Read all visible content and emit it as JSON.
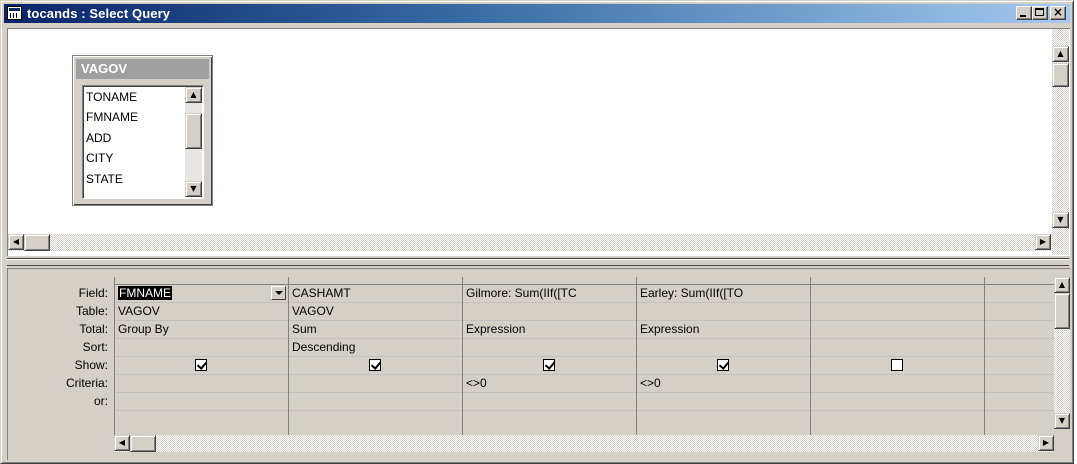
{
  "window": {
    "title": "tocands : Select Query",
    "controls": {
      "minimize": "_",
      "maximize": "□",
      "close": "×"
    }
  },
  "field_list": {
    "table_name": "VAGOV",
    "fields": [
      "TONAME",
      "FMNAME",
      "ADD",
      "CITY",
      "STATE"
    ]
  },
  "grid": {
    "row_labels": {
      "field": "Field:",
      "table": "Table:",
      "total": "Total:",
      "sort": "Sort:",
      "show": "Show:",
      "criteria": "Criteria:",
      "or": "or:"
    },
    "columns": [
      {
        "field": "FMNAME",
        "table": "VAGOV",
        "total": "Group By",
        "sort": "",
        "show": true,
        "criteria": "",
        "or": ""
      },
      {
        "field": "CASHAMT",
        "table": "VAGOV",
        "total": "Sum",
        "sort": "Descending",
        "show": true,
        "criteria": "",
        "or": ""
      },
      {
        "field": "Gilmore: Sum(IIf([TC",
        "table": "",
        "total": "Expression",
        "sort": "",
        "show": true,
        "criteria": "<>0",
        "or": ""
      },
      {
        "field": "Earley: Sum(IIf([TO",
        "table": "",
        "total": "Expression",
        "sort": "",
        "show": true,
        "criteria": "<>0",
        "or": ""
      },
      {
        "field": "",
        "table": "",
        "total": "",
        "sort": "",
        "show": false,
        "criteria": "",
        "or": ""
      },
      {
        "field": "",
        "table": "",
        "total": "",
        "sort": "",
        "show": null,
        "criteria": "",
        "or": ""
      }
    ]
  }
}
